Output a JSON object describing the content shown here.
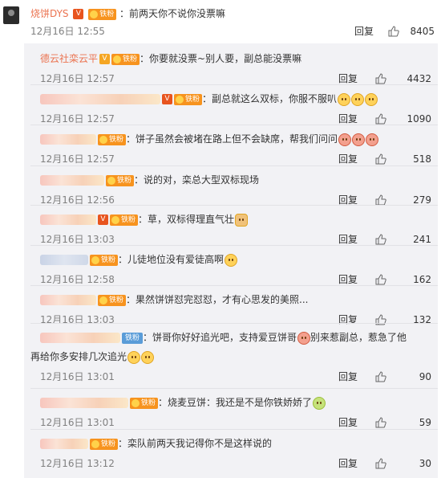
{
  "top": {
    "name": "烧饼DYS",
    "text": "：前两天你不说你没票嘛",
    "date": "12月16日 12:55",
    "reply": "回复",
    "likes": "8405"
  },
  "badge_label": "铁粉",
  "replies": [
    {
      "name": "德云社栾云平",
      "name_visible": true,
      "vip": "gold",
      "text": "：你要就没票~别人要，副总能没票嘛",
      "date": "12月16日 12:57",
      "reply": "回复",
      "likes": "4432",
      "emojis": []
    },
    {
      "name": "",
      "name_visible": false,
      "vip": "red",
      "text": "：副总就这么双标，你服不服叭",
      "date": "12月16日 12:57",
      "reply": "回复",
      "likes": "1090",
      "emojis": [
        "smile",
        "smile",
        "smile"
      ]
    },
    {
      "name": "",
      "name_visible": false,
      "vip": "",
      "text": "：饼子虽然会被堵在路上但不会缺席，帮我们问问",
      "date": "12月16日 12:57",
      "reply": "回复",
      "likes": "518",
      "emojis": [
        "red",
        "red",
        "red"
      ]
    },
    {
      "name": "",
      "name_visible": false,
      "vip": "",
      "text": "：说的对，栾总大型双标现场",
      "date": "12月16日 12:56",
      "reply": "回复",
      "likes": "279",
      "emojis": []
    },
    {
      "name": "",
      "name_visible": false,
      "vip": "red",
      "text": "：草，双标得理直气壮",
      "date": "12月16日 13:03",
      "reply": "回复",
      "likes": "241",
      "emojis": [
        "person"
      ]
    },
    {
      "name": "",
      "name_visible": false,
      "vip": "",
      "text": "：儿徒地位没有爱徒高啊",
      "date": "12月16日 12:58",
      "reply": "回复",
      "likes": "162",
      "emojis": [
        "smile"
      ]
    },
    {
      "name": "",
      "name_visible": false,
      "vip": "",
      "text": "：果然饼饼怼完怼怼，才有心思发的美照...",
      "date": "12月16日 13:03",
      "reply": "回复",
      "likes": "132",
      "emojis": []
    },
    {
      "name": "",
      "name_visible": false,
      "vip": "",
      "text": "：饼哥你好好追光吧，支持爱豆饼哥",
      "text2": "再给你多安排几次追光",
      "text_mid": "别来惹副总，惹急了他",
      "date": "12月16日 13:01",
      "reply": "回复",
      "likes": "90",
      "emojis": [
        "smile",
        "smile"
      ]
    },
    {
      "name": "",
      "name_visible": false,
      "vip": "",
      "text": "：烧麦豆饼：我还是不是你铁娇娇了",
      "date": "12月16日 13:01",
      "reply": "回复",
      "likes": "59",
      "emojis": [
        "green"
      ]
    },
    {
      "name": "",
      "name_visible": false,
      "vip": "",
      "text": "：栾队前两天我记得你不是这样说的",
      "date": "12月16日 13:12",
      "reply": "回复",
      "likes": "30",
      "emojis": []
    }
  ],
  "colors": {
    "accent": "#eb7350",
    "panel": "#f2f2f5",
    "badge": "#f7931e"
  }
}
